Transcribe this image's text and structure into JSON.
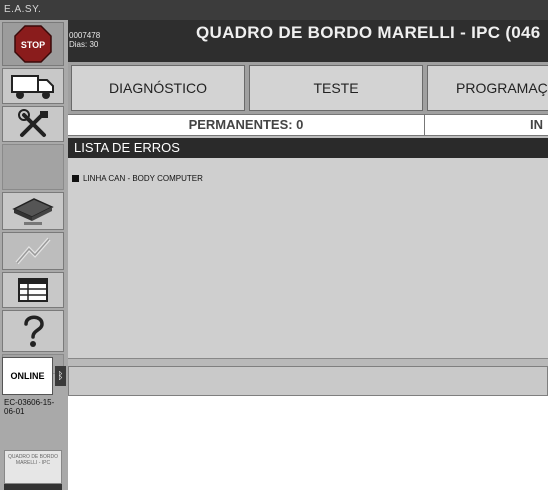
{
  "window": {
    "title": "E.A.SY."
  },
  "session": {
    "code": "0007478",
    "days": "Dias: 30"
  },
  "page": {
    "title": "QUADRO DE BORDO MARELLI - IPC (046"
  },
  "sidebar": {
    "stop_label": "STOP",
    "online_label": "ONLINE",
    "ecu_code": "EC-03606-15-06-01",
    "module_thumb_label": "QUADRO DE BORDO MARELLI - IPC"
  },
  "tabs": [
    {
      "label": "DIAGNÓSTICO"
    },
    {
      "label": "TESTE"
    },
    {
      "label": "PROGRAMAÇ"
    }
  ],
  "counters": {
    "permanent": "PERMANENTES: 0",
    "intermittent": "IN"
  },
  "errors": {
    "header": "LISTA DE ERROS",
    "items": [
      {
        "label": "LINHA CAN - BODY COMPUTER"
      }
    ]
  },
  "icons": [
    "stop-icon",
    "truck-icon",
    "tools-icon",
    "ecu-icon",
    "signal-icon",
    "table-icon",
    "help-icon",
    "bluetooth-icon"
  ],
  "colors": {
    "title_bar": "#3c3c3c",
    "header_bar": "#2e2e2e",
    "stop_red": "#8a1c1c"
  }
}
